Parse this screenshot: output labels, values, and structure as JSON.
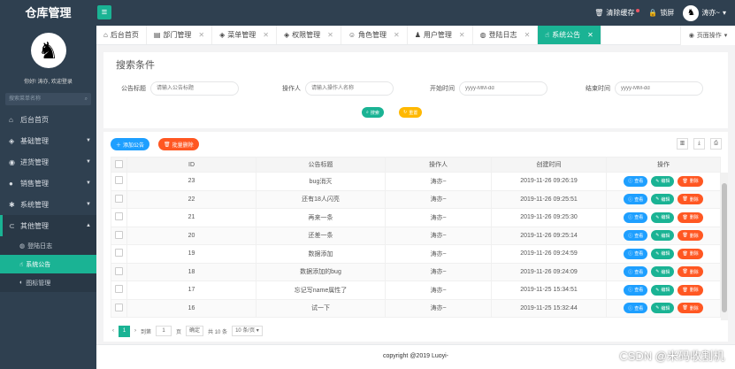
{
  "app": {
    "title": "仓库管理",
    "menu_icon": "≡"
  },
  "topbar": {
    "clear_cache": "清除缓存",
    "lock": "锁屏",
    "user": "涛亦~"
  },
  "sidebar": {
    "welcome": "你好! 涛亦, 欢迎登录",
    "search_placeholder": "搜索菜单名称",
    "items": [
      {
        "label": "后台首页",
        "icon": "home-icon"
      },
      {
        "label": "基础管理",
        "icon": "cube-icon"
      },
      {
        "label": "进货管理",
        "icon": "arrow-icon"
      },
      {
        "label": "销售管理",
        "icon": "sale-icon"
      },
      {
        "label": "系统管理",
        "icon": "gear-icon"
      },
      {
        "label": "其他管理",
        "icon": "link-icon"
      }
    ],
    "sub_items": [
      {
        "label": "登陆日志"
      },
      {
        "label": "系统公告"
      },
      {
        "label": "图标管理"
      }
    ]
  },
  "tabs": [
    {
      "label": "后台首页",
      "closable": false
    },
    {
      "label": "部门管理",
      "closable": true
    },
    {
      "label": "菜单管理",
      "closable": true
    },
    {
      "label": "权限管理",
      "closable": true
    },
    {
      "label": "角色管理",
      "closable": true
    },
    {
      "label": "用户管理",
      "closable": true
    },
    {
      "label": "登陆日志",
      "closable": true
    },
    {
      "label": "系统公告",
      "closable": true,
      "active": true
    }
  ],
  "page_op": "页面操作",
  "search": {
    "title": "搜索条件",
    "title_label": "公告标题",
    "title_placeholder": "请输入公告标题",
    "operator_label": "操作人",
    "operator_placeholder": "请输入操作人名称",
    "start_label": "开始时间",
    "start_placeholder": "yyyy-MM-dd",
    "end_label": "结束时间",
    "end_placeholder": "yyyy-MM-dd",
    "search_btn": "搜索",
    "reset_btn": "重置"
  },
  "toolbar": {
    "add_btn": "添加公告",
    "batch_delete_btn": "批量删除"
  },
  "table": {
    "headers": [
      "ID",
      "公告标题",
      "操作人",
      "创建时间",
      "操作"
    ],
    "rows": [
      {
        "id": "23",
        "title": "bug消灭",
        "operator": "涛亦~",
        "time": "2019-11-26 09:26:19"
      },
      {
        "id": "22",
        "title": "还有18人闪亮",
        "operator": "涛亦~",
        "time": "2019-11-26 09:25:51"
      },
      {
        "id": "21",
        "title": "再来一条",
        "operator": "涛亦~",
        "time": "2019-11-26 09:25:30"
      },
      {
        "id": "20",
        "title": "还差一条",
        "operator": "涛亦~",
        "time": "2019-11-26 09:25:14"
      },
      {
        "id": "19",
        "title": "数据添加",
        "operator": "涛亦~",
        "time": "2019-11-26 09:24:59"
      },
      {
        "id": "18",
        "title": "数据添加的bug",
        "operator": "涛亦~",
        "time": "2019-11-26 09:24:09"
      },
      {
        "id": "17",
        "title": "忘记写name属性了",
        "operator": "涛亦~",
        "time": "2019-11-25 15:34:51"
      },
      {
        "id": "16",
        "title": "试一下",
        "operator": "涛亦~",
        "time": "2019-11-25 15:32:44"
      }
    ],
    "actions": {
      "view": "查看",
      "edit": "编辑",
      "delete": "删除"
    }
  },
  "pager": {
    "current": "1",
    "goto": "到第",
    "page_input": "1",
    "page_unit": "页",
    "confirm": "确定",
    "total": "共 10 条",
    "per_page": "10 条/页"
  },
  "footer": "copyright @2019 Luoyi-",
  "watermark": "CSDN @米码收割机",
  "colors": {
    "primary": "#1ab394",
    "blue": "#1e9fff",
    "orange": "#ff5722",
    "yellow": "#ffb800",
    "sidebar": "#2f4050"
  }
}
